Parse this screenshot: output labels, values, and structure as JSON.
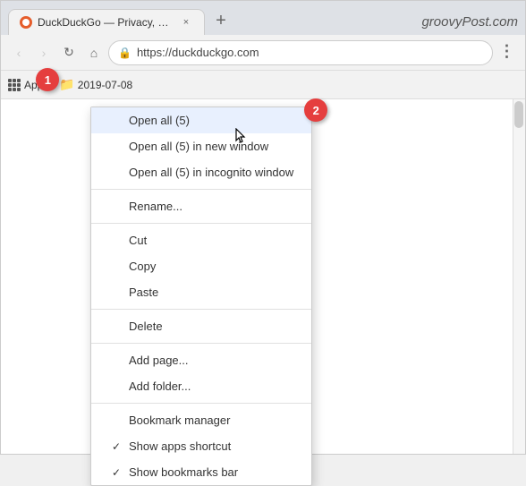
{
  "browser": {
    "tab": {
      "favicon_alt": "DuckDuckGo favicon",
      "title": "DuckDuckGo — Privacy, simplifie...",
      "close_label": "×"
    },
    "new_tab_label": "+",
    "site_label": "groovyPost.com",
    "nav": {
      "back_label": "‹",
      "forward_label": "›",
      "reload_label": "↻",
      "home_label": "⌂",
      "url": "https://duckduckgo.com",
      "lock_symbol": "🔒"
    },
    "bookmarks_bar": {
      "apps_label": "Apps",
      "folder_name": "2019-07-08"
    }
  },
  "context_menu": {
    "items": [
      {
        "id": "open-all",
        "label": "Open all (5)",
        "checkmark": "",
        "highlighted": true
      },
      {
        "id": "open-all-new-window",
        "label": "Open all (5) in new window",
        "checkmark": "",
        "highlighted": false
      },
      {
        "id": "open-all-incognito",
        "label": "Open all (5) in incognito window",
        "checkmark": "",
        "highlighted": false
      },
      {
        "id": "sep1",
        "type": "separator"
      },
      {
        "id": "rename",
        "label": "Rename...",
        "checkmark": "",
        "highlighted": false
      },
      {
        "id": "sep2",
        "type": "separator"
      },
      {
        "id": "cut",
        "label": "Cut",
        "checkmark": "",
        "highlighted": false
      },
      {
        "id": "copy",
        "label": "Copy",
        "checkmark": "",
        "highlighted": false
      },
      {
        "id": "paste",
        "label": "Paste",
        "checkmark": "",
        "highlighted": false
      },
      {
        "id": "sep3",
        "type": "separator"
      },
      {
        "id": "delete",
        "label": "Delete",
        "checkmark": "",
        "highlighted": false
      },
      {
        "id": "sep4",
        "type": "separator"
      },
      {
        "id": "add-page",
        "label": "Add page...",
        "checkmark": "",
        "highlighted": false
      },
      {
        "id": "add-folder",
        "label": "Add folder...",
        "checkmark": "",
        "highlighted": false
      },
      {
        "id": "sep5",
        "type": "separator"
      },
      {
        "id": "bookmark-manager",
        "label": "Bookmark manager",
        "checkmark": "",
        "highlighted": false
      },
      {
        "id": "show-apps",
        "label": "Show apps shortcut",
        "checkmark": "✓",
        "highlighted": false
      },
      {
        "id": "show-bookmarks",
        "label": "Show bookmarks bar",
        "checkmark": "✓",
        "highlighted": false
      }
    ]
  },
  "annotations": {
    "one": "1",
    "two": "2"
  }
}
